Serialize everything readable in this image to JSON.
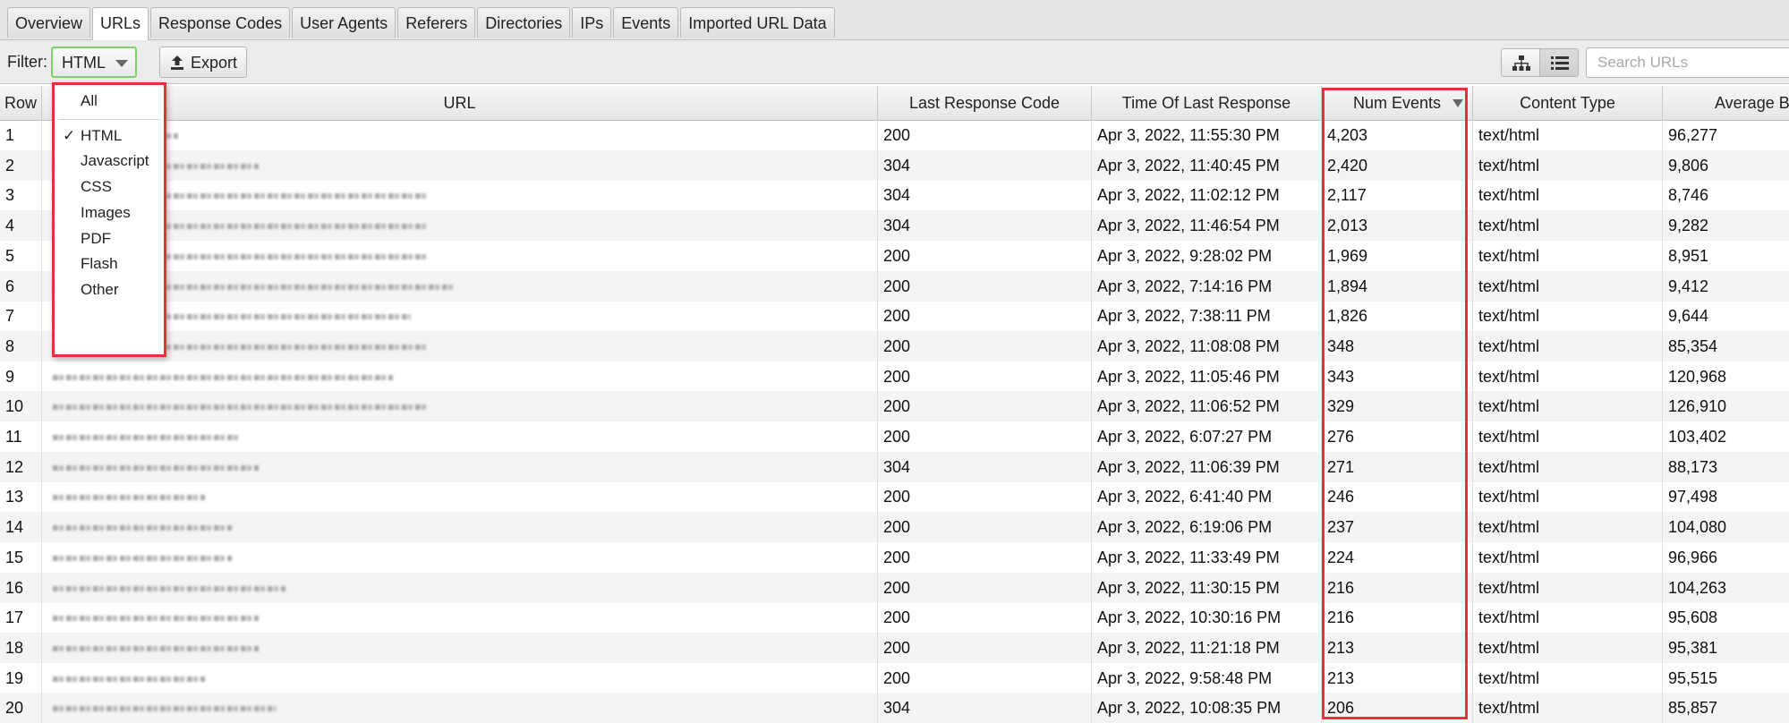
{
  "tabs": [
    {
      "label": "Overview",
      "active": false
    },
    {
      "label": "URLs",
      "active": true
    },
    {
      "label": "Response Codes",
      "active": false
    },
    {
      "label": "User Agents",
      "active": false
    },
    {
      "label": "Referers",
      "active": false
    },
    {
      "label": "Directories",
      "active": false
    },
    {
      "label": "IPs",
      "active": false
    },
    {
      "label": "Events",
      "active": false
    },
    {
      "label": "Imported URL Data",
      "active": false
    }
  ],
  "toolbar": {
    "filter_label": "Filter:",
    "filter_value": "HTML",
    "export_label": "Export",
    "search_placeholder": "Search URLs"
  },
  "filter_menu": {
    "items": [
      "All",
      "HTML",
      "Javascript",
      "CSS",
      "Images",
      "PDF",
      "Flash",
      "Other"
    ],
    "selected": "HTML",
    "check_glyph": "✓"
  },
  "table": {
    "columns": [
      "Row",
      "URL",
      "Last Response Code",
      "Time Of Last Response",
      "Num Events",
      "Content Type",
      "Average Byte"
    ],
    "sorted_column": "Num Events",
    "sort_direction": "descending",
    "rows": [
      [
        "1",
        "",
        "200",
        "Apr 3, 2022, 11:55:30 PM",
        "4,203",
        "text/html",
        "96,277"
      ],
      [
        "2",
        "",
        "304",
        "Apr 3, 2022, 11:40:45 PM",
        "2,420",
        "text/html",
        "9,806"
      ],
      [
        "3",
        "",
        "304",
        "Apr 3, 2022, 11:02:12 PM",
        "2,117",
        "text/html",
        "8,746"
      ],
      [
        "4",
        "",
        "304",
        "Apr 3, 2022, 11:46:54 PM",
        "2,013",
        "text/html",
        "9,282"
      ],
      [
        "5",
        "",
        "200",
        "Apr 3, 2022, 9:28:02 PM",
        "1,969",
        "text/html",
        "8,951"
      ],
      [
        "6",
        "",
        "200",
        "Apr 3, 2022, 7:14:16 PM",
        "1,894",
        "text/html",
        "9,412"
      ],
      [
        "7",
        "",
        "200",
        "Apr 3, 2022, 7:38:11 PM",
        "1,826",
        "text/html",
        "9,644"
      ],
      [
        "8",
        "",
        "200",
        "Apr 3, 2022, 11:08:08 PM",
        "348",
        "text/html",
        "85,354"
      ],
      [
        "9",
        "",
        "200",
        "Apr 3, 2022, 11:05:46 PM",
        "343",
        "text/html",
        "120,968"
      ],
      [
        "10",
        "",
        "200",
        "Apr 3, 2022, 11:06:52 PM",
        "329",
        "text/html",
        "126,910"
      ],
      [
        "11",
        "",
        "200",
        "Apr 3, 2022, 6:07:27 PM",
        "276",
        "text/html",
        "103,402"
      ],
      [
        "12",
        "",
        "304",
        "Apr 3, 2022, 11:06:39 PM",
        "271",
        "text/html",
        "88,173"
      ],
      [
        "13",
        "",
        "200",
        "Apr 3, 2022, 6:41:40 PM",
        "246",
        "text/html",
        "97,498"
      ],
      [
        "14",
        "",
        "200",
        "Apr 3, 2022, 6:19:06 PM",
        "237",
        "text/html",
        "104,080"
      ],
      [
        "15",
        "",
        "200",
        "Apr 3, 2022, 11:33:49 PM",
        "224",
        "text/html",
        "96,966"
      ],
      [
        "16",
        "",
        "200",
        "Apr 3, 2022, 11:30:15 PM",
        "216",
        "text/html",
        "104,263"
      ],
      [
        "17",
        "",
        "200",
        "Apr 3, 2022, 10:30:16 PM",
        "216",
        "text/html",
        "95,608"
      ],
      [
        "18",
        "",
        "200",
        "Apr 3, 2022, 11:21:18 PM",
        "213",
        "text/html",
        "95,381"
      ],
      [
        "19",
        "",
        "200",
        "Apr 3, 2022, 9:58:48 PM",
        "213",
        "text/html",
        "95,515"
      ],
      [
        "20",
        "",
        "304",
        "Apr 3, 2022, 10:08:35 PM",
        "206",
        "text/html",
        "85,857"
      ]
    ]
  },
  "colors": {
    "highlight": "#e8303a",
    "filter_focus": "#7fd06a"
  }
}
